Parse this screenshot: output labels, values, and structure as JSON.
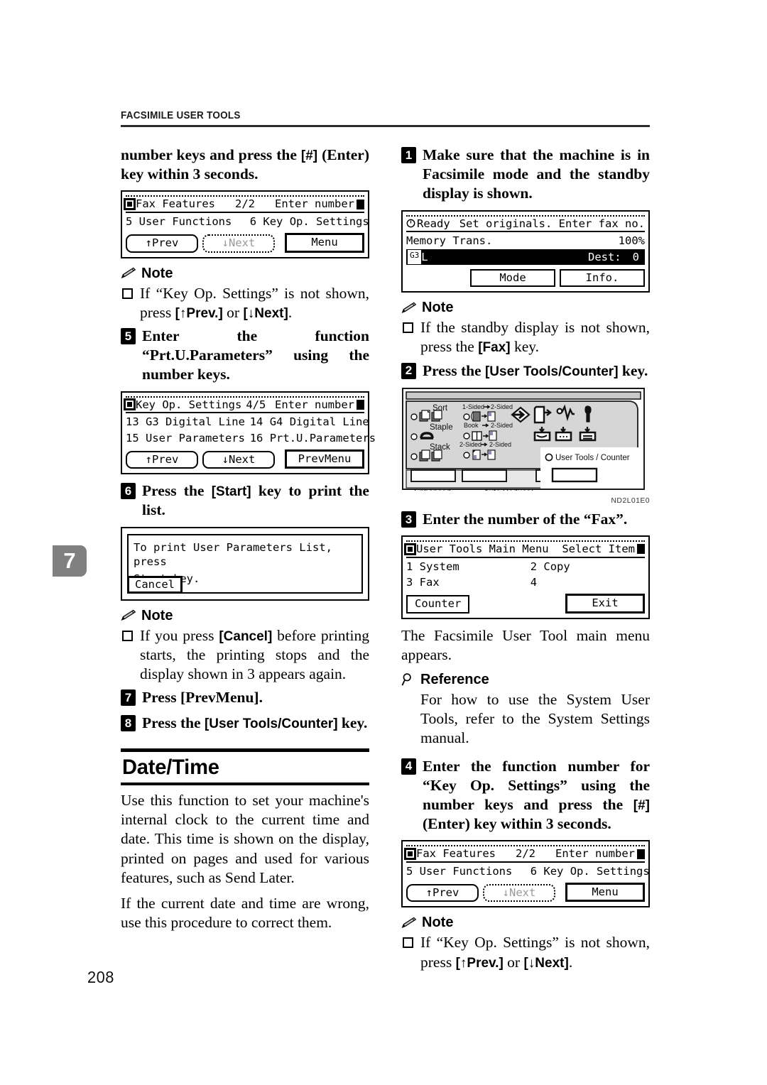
{
  "header": {
    "running_head": "FACSIMILE USER TOOLS"
  },
  "chapter_tab": {
    "number": "7"
  },
  "page_number": "208",
  "left_column": {
    "continued_step_text_1": "number  keys  and  press  the  ",
    "continued_step_key": "[#]",
    "continued_step_text_2": "(Enter) key within 3 seconds.",
    "lcd_fax_features": {
      "title": "Fax Features",
      "page_indicator": "2/2",
      "prompt": "Enter number",
      "item_left": "5 User Functions",
      "item_right": "6 Key Op. Settings",
      "btn_prev": "↑Prev",
      "btn_next": "↓Next",
      "btn_menu": "Menu"
    },
    "note1": {
      "label": "Note",
      "text_a": "If  “Key  Op.  Settings”  is  not shown, press ",
      "key_prev": "[↑Prev.]",
      "text_b": " or ",
      "key_next": "[↓Next]",
      "text_c": "."
    },
    "step5": {
      "number": "5",
      "text": "Enter the function “Prt.U.Parameters” using the number keys."
    },
    "lcd_key_op": {
      "title": "Key Op. Settings",
      "page_indicator": "4/5",
      "prompt": "Enter number",
      "row1_left": "13 G3 Digital Line",
      "row1_right": "14 G4 Digital Line",
      "row2_left": "15 User Parameters",
      "row2_right": "16 Prt.U.Parameters",
      "btn_prev": "↑Prev",
      "btn_next": "↓Next",
      "btn_prevmenu": "PrevMenu"
    },
    "step6": {
      "number": "6",
      "text_a": "Press the ",
      "key": "[Start]",
      "text_b": " key to print the list."
    },
    "lcd_print_dialog": {
      "line1": "To print User Parameters List, press",
      "line2": "Start key.",
      "btn_cancel": "Cancel"
    },
    "note2": {
      "label": "Note",
      "text_a": "If  you  press  ",
      "key_cancel": "[Cancel]",
      "text_b": "  before printing   starts,   the   printing stops and the display shown in 3 appears again."
    },
    "step7": {
      "number": "7",
      "text": "Press [PrevMenu]."
    },
    "step8": {
      "number": "8",
      "text_a": "Press the ",
      "key": "[User Tools/Counter]",
      "text_b": " key."
    },
    "section": {
      "title": "Date/Time",
      "para1": "Use this function to set your machine's internal clock to the current time and date. This time is shown on the display, printed on pages and used for various features, such as Send Later.",
      "para2": "If the current date and time are wrong, use this procedure to correct them."
    }
  },
  "right_column": {
    "step1": {
      "number": "1",
      "text": "Make sure that the machine is in Facsimile mode and the standby display is shown."
    },
    "lcd_standby": {
      "status": "Ready",
      "prompt": "Set originals. Enter fax no.",
      "mode_label": "Memory Trans.",
      "zoom": "100%",
      "line_badge": "G3",
      "line_suffix": "L",
      "dest_label": "Dest:",
      "dest_value": "0",
      "btn_mode": "Mode",
      "btn_info": "Info."
    },
    "note1": {
      "label": "Note",
      "text_a": "If  the  standby  display  is  not shown, press the ",
      "key_fax": "[Fax]",
      "text_b": " key."
    },
    "step2": {
      "number": "2",
      "text_a": "Press the ",
      "key": "[User Tools/Counter]",
      "text_b": " key."
    },
    "operator_panel": {
      "label_sort": "Sort",
      "label_staple": "Staple",
      "label_stack": "Stack",
      "label_1sided": "1-Sided",
      "label_2sided": "2-Sided",
      "label_book": "Book",
      "label_2sided_b": "2-Sided",
      "label_2sided_c": "2-Sided",
      "label_2sided_d": "2-Sided",
      "label_user_tools_counter": "User Tools / Counter",
      "label_enhanced": "Enhanced",
      "label_auto_reduce": "Auto Reduce/",
      "figure_code": "ND2L01E0"
    },
    "step3": {
      "number": "3",
      "text": "Enter the number of the “Fax”."
    },
    "lcd_user_tools": {
      "title": "User Tools Main Menu",
      "prompt": "Select Item",
      "item1": "1 System",
      "item2": "2 Copy",
      "item3": "3 Fax",
      "item4": "4",
      "btn_counter": "Counter",
      "btn_exit": "Exit"
    },
    "para_after_step3": "The Facsimile User Tool main menu appears.",
    "reference": {
      "label": "Reference",
      "text": "For how to use the System User Tools, refer to the System Settings manual."
    },
    "step4": {
      "number": "4",
      "text_a": "Enter the function number for “Key Op. Settings” using the number keys and press the ",
      "key_hash": "[#]",
      "text_b": " (Enter) key within 3 seconds."
    },
    "lcd_fax_features_2": {
      "title": "Fax Features",
      "page_indicator": "2/2",
      "prompt": "Enter number",
      "item_left": "5 User Functions",
      "item_right": "6 Key Op. Settings",
      "btn_prev": "↑Prev",
      "btn_next": "↓Next",
      "btn_menu": "Menu"
    },
    "note2": {
      "label": "Note",
      "text_a": "If  “Key  Op.  Settings”  is  not shown, press ",
      "key_prev": "[↑Prev.]",
      "text_b": " or ",
      "key_next": "[↓Next]",
      "text_c": "."
    }
  }
}
